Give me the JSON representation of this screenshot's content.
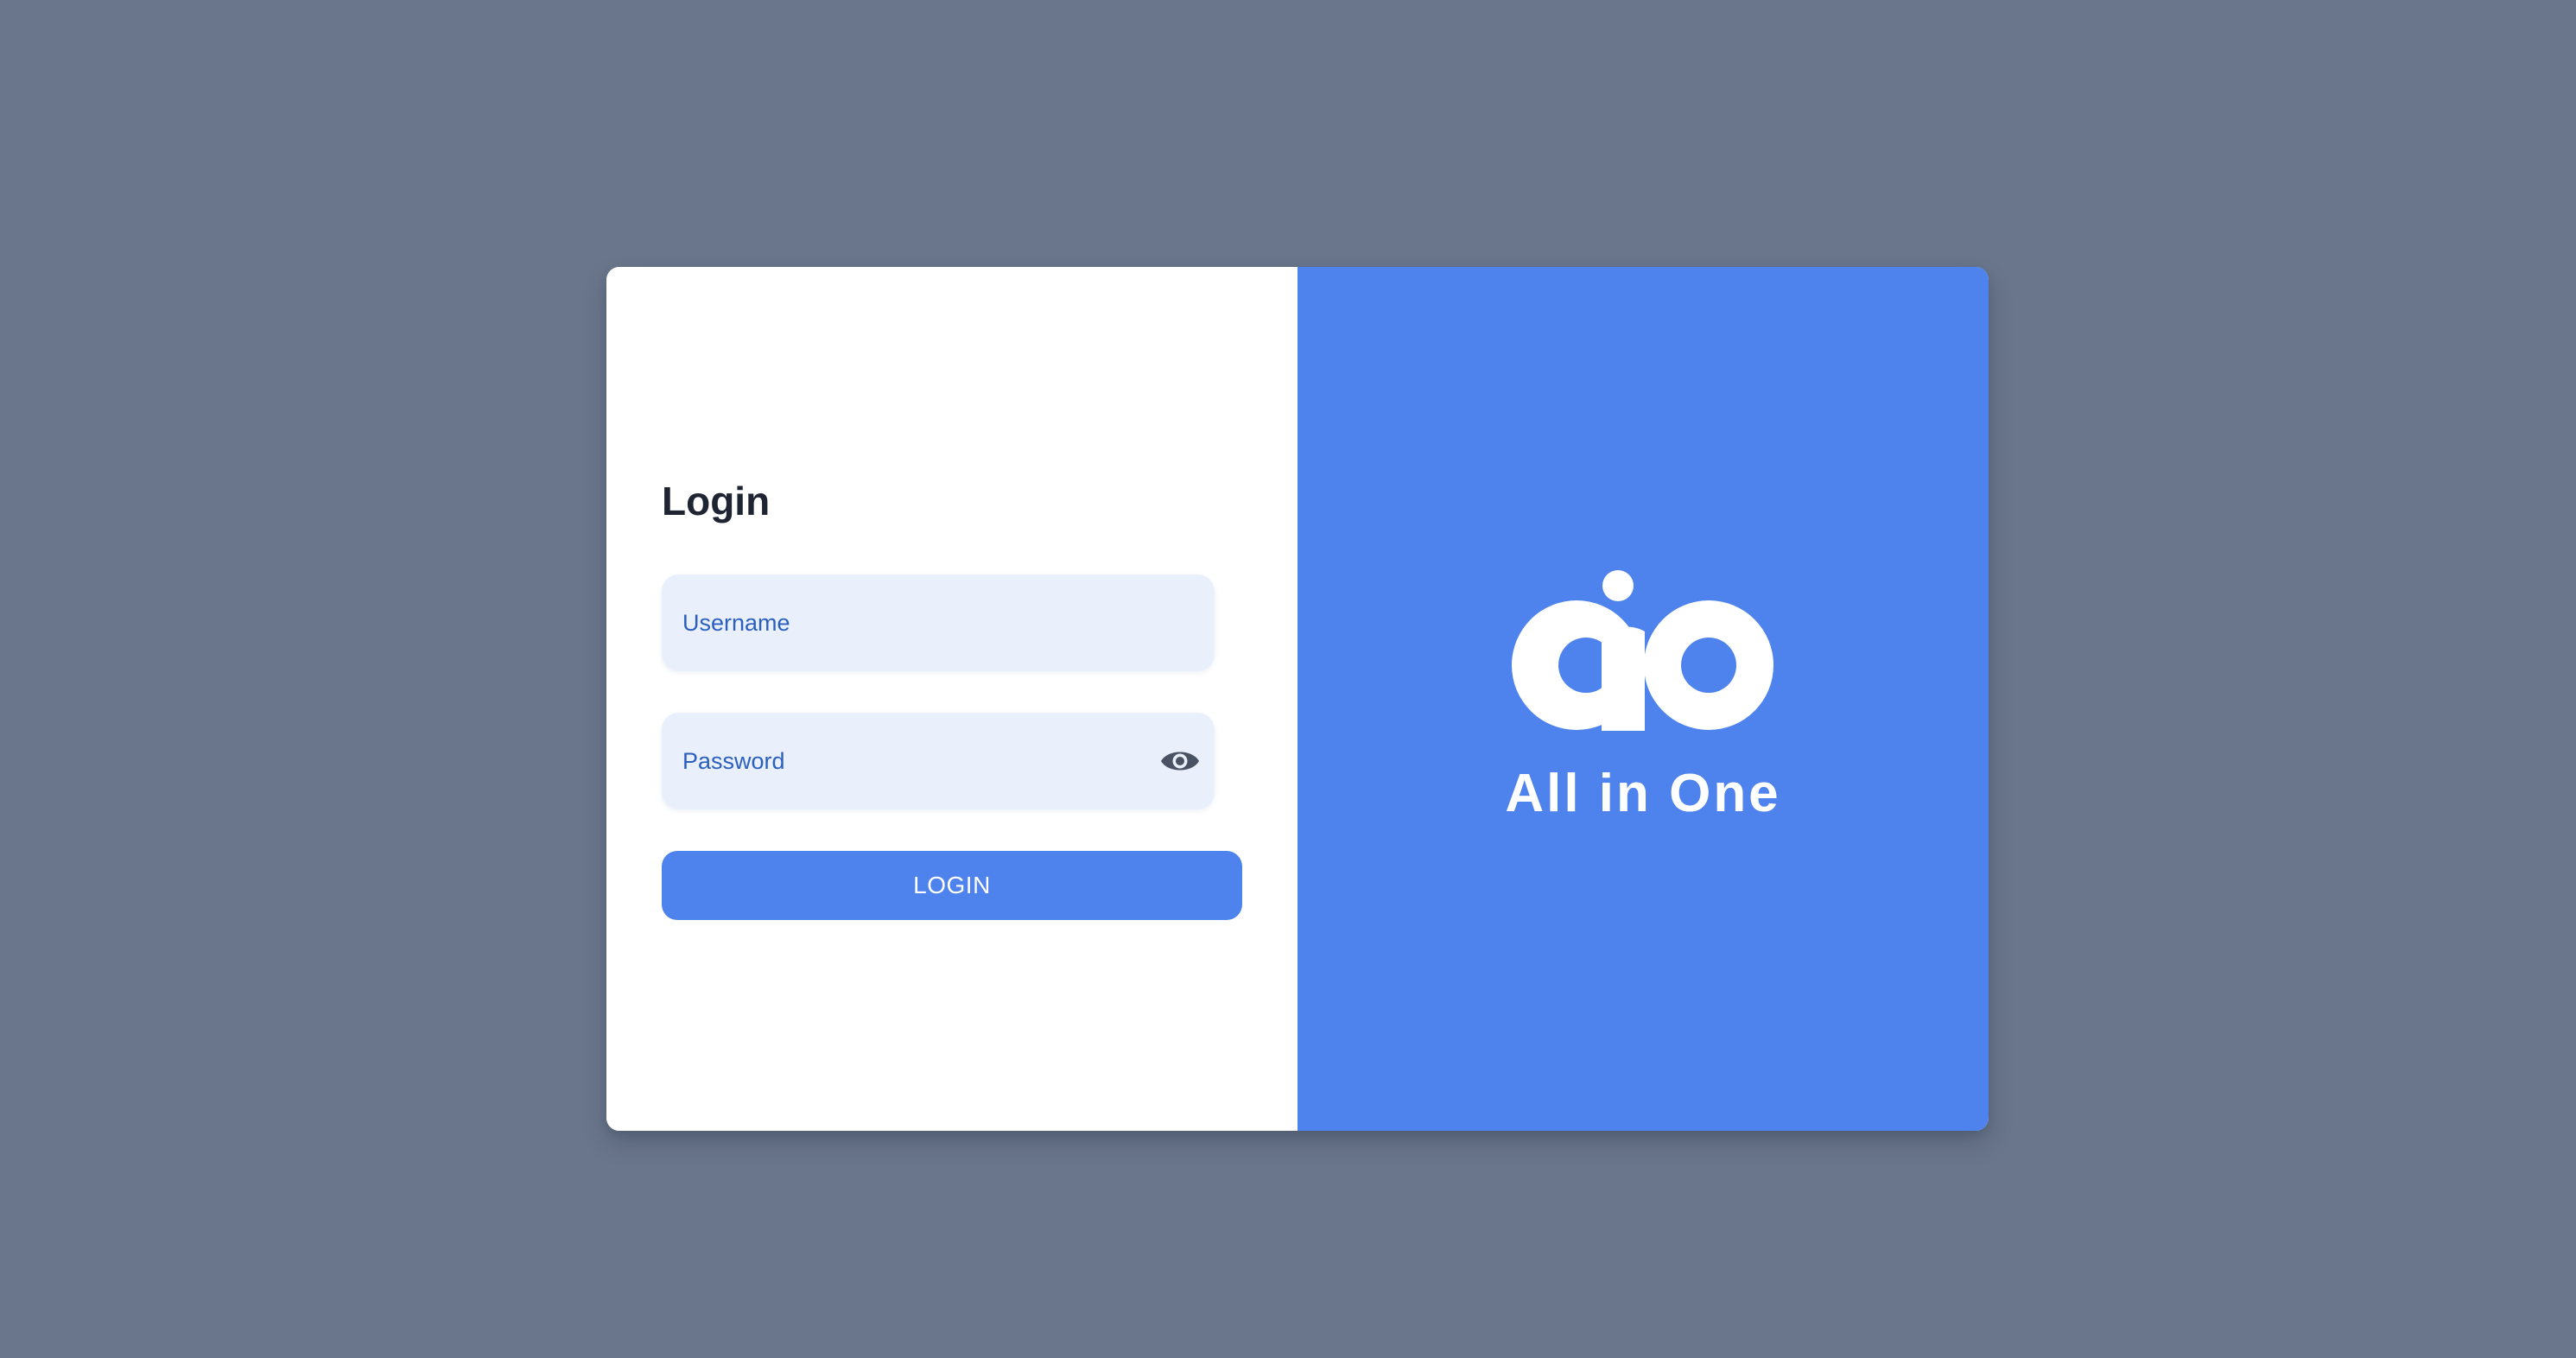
{
  "login": {
    "title": "Login",
    "username_placeholder": "Username",
    "password_placeholder": "Password",
    "submit_label": "LOGIN"
  },
  "brand": {
    "name": "All in One",
    "logo_icon": "aio-logo-icon"
  },
  "icons": {
    "password_toggle": "eye-icon"
  },
  "colors": {
    "page_background": "#6a768b",
    "accent": "#4e82ed",
    "input_background": "#e9f0fc",
    "input_text": "#2a5fbf",
    "title_text": "#1e2432",
    "eye_icon": "#4a5363"
  }
}
